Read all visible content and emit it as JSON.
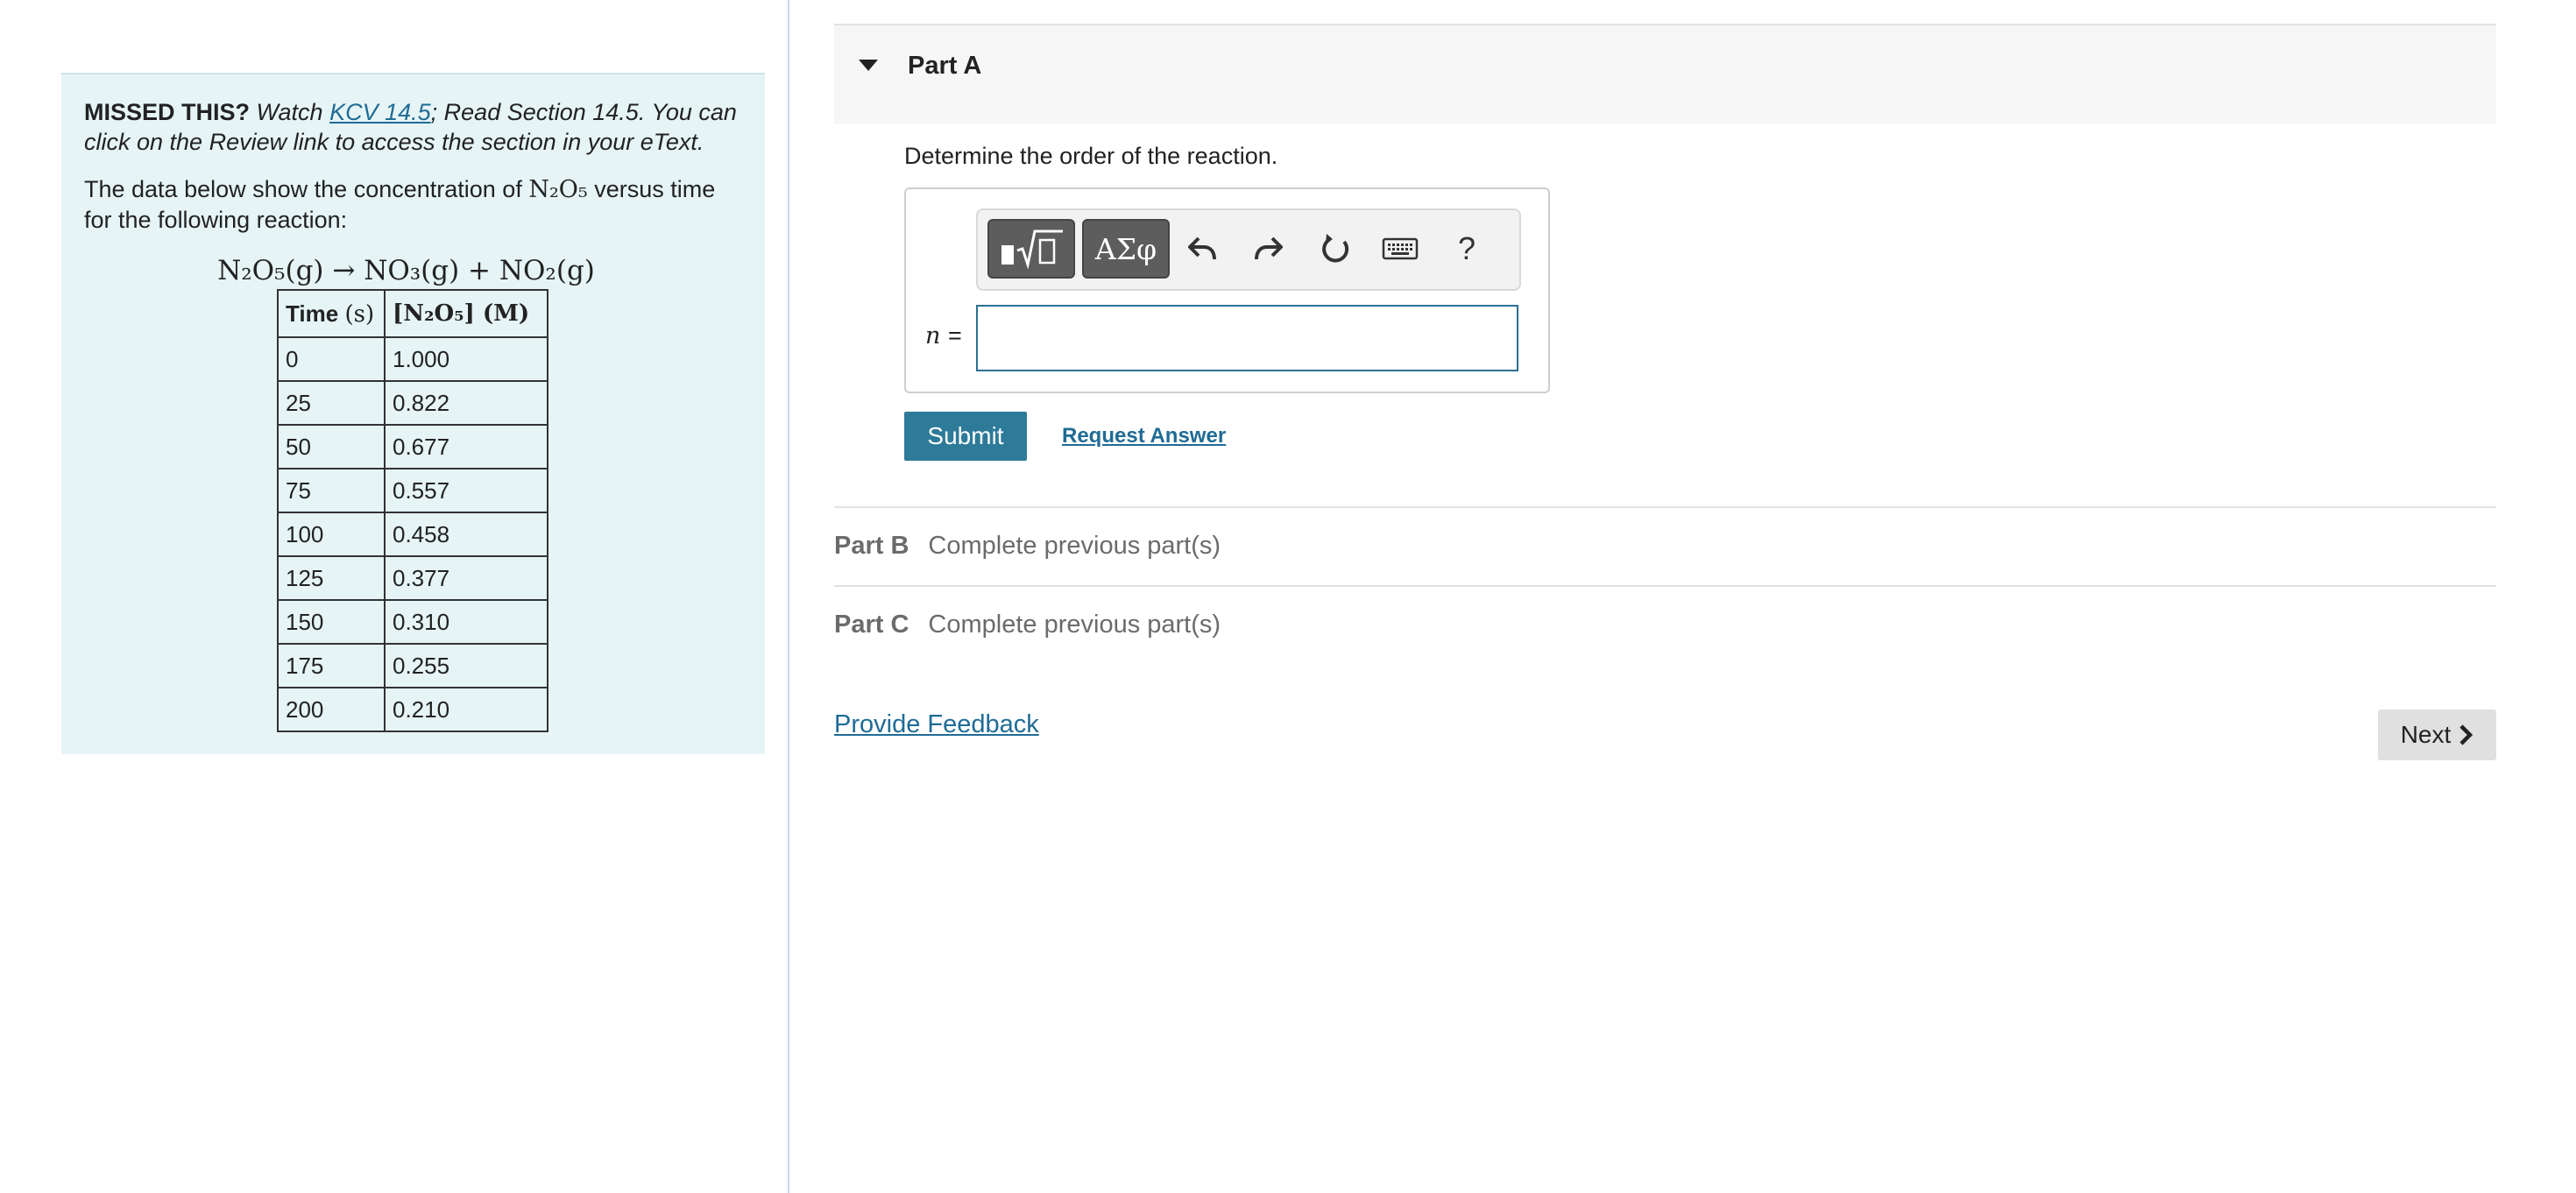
{
  "intro": {
    "missed_bold": "MISSED THIS?",
    "missed_watch": "Watch",
    "missed_link": "KCV 14.5",
    "missed_rest": "; Read Section 14.5. You can click on the Review link to access the section in your eText.",
    "data_sentence_start": "The data below show the concentration of",
    "data_sentence_end": "versus time for the following reaction:",
    "species": "N₂O₅",
    "equation": "N₂O₅(g) → NO₃(g) + NO₂(g)"
  },
  "table": {
    "header_time": "Time",
    "header_time_unit": "(s)",
    "header_conc": "[N₂O₅] (M)",
    "rows": [
      {
        "time": "0",
        "conc": "1.000"
      },
      {
        "time": "25",
        "conc": "0.822"
      },
      {
        "time": "50",
        "conc": "0.677"
      },
      {
        "time": "75",
        "conc": "0.557"
      },
      {
        "time": "100",
        "conc": "0.458"
      },
      {
        "time": "125",
        "conc": "0.377"
      },
      {
        "time": "150",
        "conc": "0.310"
      },
      {
        "time": "175",
        "conc": "0.255"
      },
      {
        "time": "200",
        "conc": "0.210"
      }
    ]
  },
  "part_a": {
    "title": "Part A",
    "question": "Determine the order of the reaction.",
    "symbols_label": "ΑΣφ",
    "help_label": "?",
    "var_label": "n",
    "equals": "=",
    "input_value": "",
    "submit_label": "Submit",
    "request_label": "Request Answer"
  },
  "part_b": {
    "title": "Part B",
    "status": "Complete previous part(s)"
  },
  "part_c": {
    "title": "Part C",
    "status": "Complete previous part(s)"
  },
  "footer": {
    "feedback_label": "Provide Feedback",
    "next_label": "Next"
  }
}
